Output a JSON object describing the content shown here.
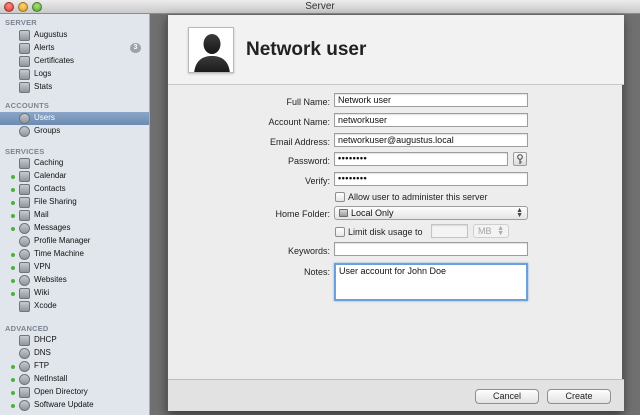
{
  "window": {
    "title": "Server"
  },
  "sidebar": {
    "sections": [
      {
        "header": "SERVER",
        "items": [
          {
            "label": "Augustus",
            "icon": "server-icon"
          },
          {
            "label": "Alerts",
            "icon": "megaphone-icon",
            "badge": "3"
          },
          {
            "label": "Certificates",
            "icon": "certificate-icon"
          },
          {
            "label": "Logs",
            "icon": "document-icon"
          },
          {
            "label": "Stats",
            "icon": "bar-chart-icon"
          }
        ]
      },
      {
        "header": "ACCOUNTS",
        "items": [
          {
            "label": "Users",
            "icon": "user-icon",
            "selected": true
          },
          {
            "label": "Groups",
            "icon": "group-icon"
          }
        ]
      },
      {
        "header": "SERVICES",
        "items": [
          {
            "label": "Caching",
            "icon": "caching-icon"
          },
          {
            "label": "Calendar",
            "icon": "calendar-icon",
            "status": "on"
          },
          {
            "label": "Contacts",
            "icon": "contacts-icon",
            "status": "on"
          },
          {
            "label": "File Sharing",
            "icon": "folder-icon",
            "status": "on"
          },
          {
            "label": "Mail",
            "icon": "mail-icon",
            "status": "on"
          },
          {
            "label": "Messages",
            "icon": "messages-icon",
            "status": "on"
          },
          {
            "label": "Profile Manager",
            "icon": "profile-manager-icon"
          },
          {
            "label": "Time Machine",
            "icon": "time-machine-icon",
            "status": "on"
          },
          {
            "label": "VPN",
            "icon": "vpn-icon",
            "status": "on"
          },
          {
            "label": "Websites",
            "icon": "globe-icon",
            "status": "on"
          },
          {
            "label": "Wiki",
            "icon": "wiki-icon",
            "status": "on"
          },
          {
            "label": "Xcode",
            "icon": "hammer-icon"
          }
        ]
      },
      {
        "header": "ADVANCED",
        "items": [
          {
            "label": "DHCP",
            "icon": "dhcp-icon"
          },
          {
            "label": "DNS",
            "icon": "dns-icon"
          },
          {
            "label": "FTP",
            "icon": "ftp-icon",
            "status": "on"
          },
          {
            "label": "NetInstall",
            "icon": "netinstall-icon",
            "status": "on"
          },
          {
            "label": "Open Directory",
            "icon": "open-directory-icon",
            "status": "on"
          },
          {
            "label": "Software Update",
            "icon": "software-update-icon",
            "status": "on"
          }
        ]
      }
    ]
  },
  "sheet": {
    "title": "Network user",
    "avatar_icon": "user-silhouette-icon",
    "form": {
      "full_name_label": "Full Name:",
      "full_name_value": "Network user",
      "account_name_label": "Account Name:",
      "account_name_value": "networkuser",
      "email_label": "Email Address:",
      "email_value": "networkuser@augustus.local",
      "password_label": "Password:",
      "password_value": "••••••••",
      "password_assistant_icon": "key-icon",
      "verify_label": "Verify:",
      "verify_value": "••••••••",
      "admin_checkbox_label": "Allow user to administer this server",
      "admin_checked": false,
      "home_folder_label": "Home Folder:",
      "home_folder_value": "Local Only",
      "limit_checkbox_label": "Limit disk usage to",
      "limit_checked": false,
      "limit_value": "",
      "limit_unit": "MB",
      "keywords_label": "Keywords:",
      "keywords_value": "",
      "notes_label": "Notes:",
      "notes_value": "User account for John Doe"
    },
    "cancel_label": "Cancel",
    "create_label": "Create"
  },
  "colors": {
    "selection": "#7592b8",
    "status_dot": "#4db13b",
    "focus_ring": "#6f9fd8"
  }
}
